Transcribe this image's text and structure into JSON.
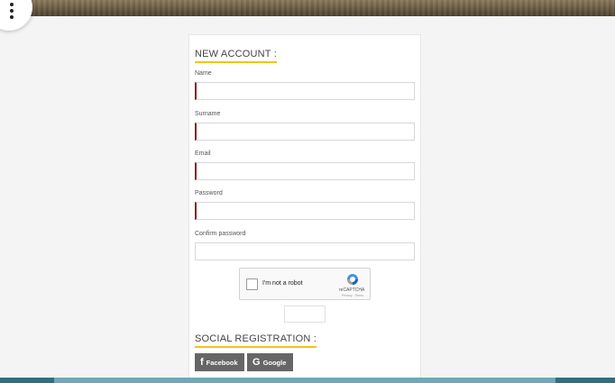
{
  "form": {
    "title": "NEW ACCOUNT :",
    "fields": [
      {
        "label": "Name",
        "value": ""
      },
      {
        "label": "Surname",
        "value": ""
      },
      {
        "label": "Email",
        "value": ""
      },
      {
        "label": "Password",
        "value": ""
      },
      {
        "label": "Confirm password",
        "value": ""
      }
    ]
  },
  "captcha": {
    "label": "I'm not a robot",
    "brand": "reCAPTCHA",
    "terms": "Privacy - Terms"
  },
  "social": {
    "title": "SOCIAL REGISTRATION :",
    "facebook_label": "Facebook",
    "google_label": "Google"
  },
  "colors": {
    "accent_underline": "#f0c419",
    "required_marker": "#8b1a1a",
    "social_button": "#666666"
  },
  "icons": {
    "menu": "more-vertical-icon",
    "facebook": "facebook-icon",
    "google": "google-icon",
    "recaptcha": "recaptcha-icon"
  }
}
